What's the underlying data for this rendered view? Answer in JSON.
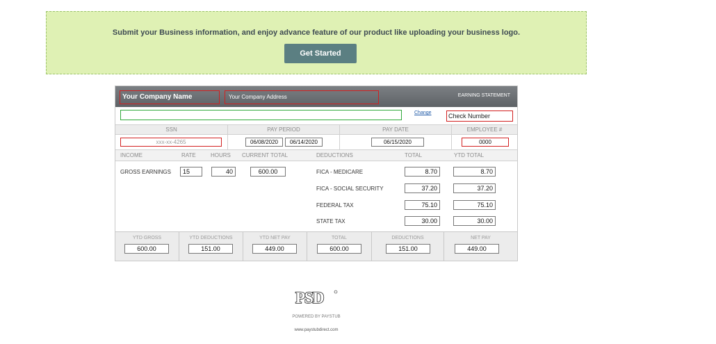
{
  "banner": {
    "message": "Submit your Business information, and enjoy advance feature of our product like uploading your business logo.",
    "button_label": "Get Started"
  },
  "stub": {
    "company_name": "Your Company Name",
    "company_address": "Your Company Address",
    "title": "EARNING STATEMENT",
    "change_link": "Change",
    "check_number": "Check Number",
    "headers": {
      "ssn": "SSN",
      "pay_period": "PAY PERIOD",
      "pay_date": "PAY DATE",
      "employee": "EMPLOYEE #"
    },
    "values": {
      "ssn": "xxx-xx-4265",
      "period_start": "06/08/2020",
      "period_end": "06/14/2020",
      "pay_date": "06/15/2020",
      "employee": "0000"
    },
    "columns": {
      "income": "INCOME",
      "rate": "RATE",
      "hours": "HOURS",
      "current_total": "CURRENT TOTAL",
      "deductions": "DEDUCTIONS",
      "total": "TOTAL",
      "ytd_total": "YTD TOTAL"
    },
    "earnings": {
      "label": "GROSS EARNINGS",
      "rate": "15",
      "hours": "40",
      "current_total": "600.00"
    },
    "deductions": [
      {
        "label": "FICA - MEDICARE",
        "total": "8.70",
        "ytd": "8.70"
      },
      {
        "label": "FICA - SOCIAL SECURITY",
        "total": "37.20",
        "ytd": "37.20"
      },
      {
        "label": "FEDERAL TAX",
        "total": "75.10",
        "ytd": "75.10"
      },
      {
        "label": "STATE TAX",
        "total": "30.00",
        "ytd": "30.00"
      }
    ],
    "totals": [
      {
        "label": "YTD GROSS",
        "value": "600.00"
      },
      {
        "label": "YTD DEDUCTIONS",
        "value": "151.00"
      },
      {
        "label": "YTD NET PAY",
        "value": "449.00"
      },
      {
        "label": "TOTAL",
        "value": "600.00"
      },
      {
        "label": "DEDUCTIONS",
        "value": "151.00"
      },
      {
        "label": "NET PAY",
        "value": "449.00"
      }
    ]
  },
  "footer": {
    "logo_text": "PSD",
    "powered_by": "POWERED BY PAYSTUB",
    "website": "www.paystubdirect.com"
  }
}
